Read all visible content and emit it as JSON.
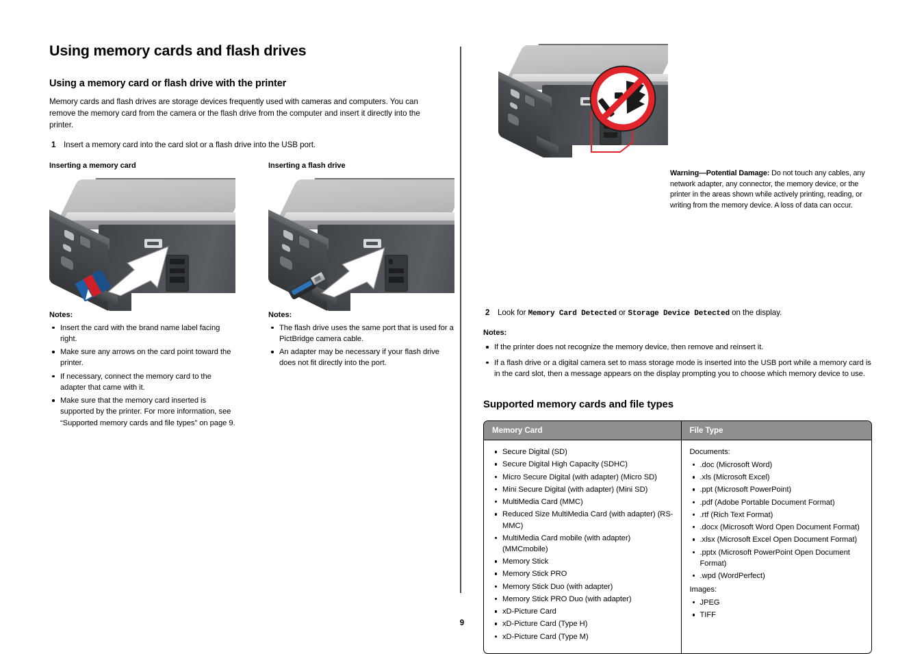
{
  "document": {
    "page_number": "9"
  },
  "left_column": {
    "title": "Using memory cards and flash drives",
    "section_heading": "Using a memory card or flash drive with the printer",
    "intro_paragraph": "Memory cards and flash drives are storage devices frequently used with cameras and computers. You can remove the memory card from the camera or the flash drive from the computer and insert it directly into the printer.",
    "step1": {
      "number": "1",
      "text": "Insert a memory card into the card slot or a flash drive into the USB port."
    },
    "figures": [
      {
        "caption": "Inserting a memory card",
        "notes_label": "Notes:",
        "notes": [
          "Insert the card with the brand name label facing right.",
          "Make sure any arrows on the card point toward the printer.",
          "If necessary, connect the memory card to the adapter that came with it.",
          "Make sure that the memory card inserted is supported by the printer. For more information, see “Supported memory cards and file types” on page 9."
        ]
      },
      {
        "caption": "Inserting a flash drive",
        "notes_label": "Notes:",
        "notes": [
          "The flash drive uses the same port that is used for a PictBridge camera cable.",
          "An adapter may be necessary if your flash drive does not fit directly into the port."
        ]
      }
    ]
  },
  "right_column": {
    "warning": {
      "label": "Warning—Potential Damage:",
      "text": " Do not touch any cables, any network adapter, any connector, the memory device, or the printer in the areas shown while actively printing, reading, or writing from the memory device. A loss of data can occur."
    },
    "step2": {
      "number": "2",
      "prefix": "Look for ",
      "code1": "Memory Card Detected",
      "middle": " or ",
      "code2": "Storage Device Detected",
      "suffix": " on the display."
    },
    "notes_label": "Notes:",
    "notes": [
      "If the printer does not recognize the memory device, then remove and reinsert it.",
      "If a flash drive or a digital camera set to mass storage mode is inserted into the USB port while a memory card is in the card slot, then a message appears on the display prompting you to choose which memory device to use."
    ],
    "table_heading": "Supported memory cards and file types",
    "table": {
      "headers": [
        "Memory Card",
        "File Type"
      ],
      "memory_cards": [
        "Secure Digital (SD)",
        "Secure Digital High Capacity (SDHC)",
        "Micro Secure Digital (with adapter) (Micro SD)",
        "Mini Secure Digital (with adapter) (Mini SD)",
        "MultiMedia Card (MMC)",
        "Reduced Size MultiMedia Card (with adapter) (RS-MMC)",
        "MultiMedia Card mobile (with adapter) (MMCmobile)",
        "Memory Stick",
        "Memory Stick PRO",
        "Memory Stick Duo (with adapter)",
        "Memory Stick PRO Duo (with adapter)",
        "xD-Picture Card",
        "xD-Picture Card (Type H)",
        "xD-Picture Card (Type M)"
      ],
      "file_types": {
        "documents_label": "Documents:",
        "documents": [
          ".doc (Microsoft Word)",
          ".xls (Microsoft Excel)",
          ".ppt (Microsoft PowerPoint)",
          ".pdf (Adobe Portable Document Format)",
          ".rtf (Rich Text Format)",
          ".docx (Microsoft Word Open Document Format)",
          ".xlsx (Microsoft Excel Open Document Format)",
          ".pptx (Microsoft PowerPoint Open Document Format)",
          ".wpd (WordPerfect)"
        ],
        "images_label": "Images:",
        "images": [
          "JPEG",
          "TIFF"
        ]
      }
    }
  },
  "colors": {
    "table_header_bg": "#8d8f91",
    "divider": "#4d4d4d",
    "warning_red": "#e1232a",
    "sd_card_blue": "#1f5fa6",
    "sd_card_red": "#cf2027"
  },
  "icons": {
    "prohibition": "no-touch-icon",
    "card_slot": "card-slot-icon"
  }
}
